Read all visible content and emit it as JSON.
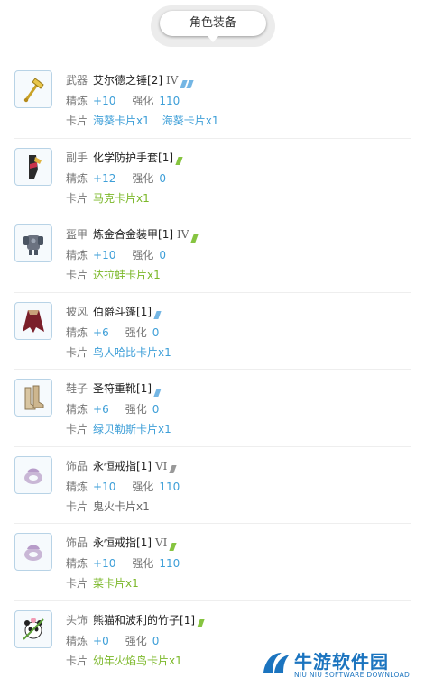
{
  "header": {
    "title": "角色装备"
  },
  "labels": {
    "refine": "精炼",
    "enhance": "强化",
    "card": "卡片"
  },
  "colors": {
    "blue": "#3e9fd8",
    "green": "#7cb82a",
    "gray": "#888888",
    "slash_blue": "#74b6e4",
    "slash_green": "#86c440",
    "slash_gray": "#999999"
  },
  "items": [
    {
      "slot": "武器",
      "name": "艾尔德之锤[2]",
      "tier": "IV",
      "slash_color": "blue",
      "slash_count": 2,
      "icon": "hammer-icon",
      "refine": "+10",
      "enhance": "110",
      "value_color": "blue",
      "cards": [
        "海葵卡片x1",
        "海葵卡片x1"
      ],
      "card_color": "blue"
    },
    {
      "slot": "副手",
      "name": "化学防护手套[1]",
      "tier": "",
      "slash_color": "green",
      "slash_count": 1,
      "icon": "glove-icon",
      "refine": "+12",
      "enhance": "0",
      "value_color": "blue",
      "cards": [
        "马克卡片x1"
      ],
      "card_color": "green"
    },
    {
      "slot": "盔甲",
      "name": "炼金合金装甲[1]",
      "tier": "IV",
      "slash_color": "green",
      "slash_count": 1,
      "icon": "armor-icon",
      "refine": "+10",
      "enhance": "0",
      "value_color": "blue",
      "cards": [
        "达拉蛙卡片x1"
      ],
      "card_color": "green"
    },
    {
      "slot": "披风",
      "name": "伯爵斗篷[1]",
      "tier": "",
      "slash_color": "blue",
      "slash_count": 1,
      "icon": "cape-icon",
      "refine": "+6",
      "enhance": "0",
      "value_color": "blue",
      "cards": [
        "鸟人哈比卡片x1"
      ],
      "card_color": "blue"
    },
    {
      "slot": "鞋子",
      "name": "圣符重靴[1]",
      "tier": "",
      "slash_color": "blue",
      "slash_count": 1,
      "icon": "boots-icon",
      "refine": "+6",
      "enhance": "0",
      "value_color": "blue",
      "cards": [
        "绿贝勒斯卡片x1"
      ],
      "card_color": "blue"
    },
    {
      "slot": "饰品",
      "name": "永恒戒指[1]",
      "tier": "VI",
      "slash_color": "gray",
      "slash_count": 1,
      "icon": "ring-icon",
      "refine": "+10",
      "enhance": "110",
      "value_color": "blue",
      "cards": [
        "鬼火卡片x1"
      ],
      "card_color": "gray"
    },
    {
      "slot": "饰品",
      "name": "永恒戒指[1]",
      "tier": "VI",
      "slash_color": "green",
      "slash_count": 1,
      "icon": "ring-icon",
      "refine": "+10",
      "enhance": "110",
      "value_color": "blue",
      "cards": [
        "菜卡片x1"
      ],
      "card_color": "green"
    },
    {
      "slot": "头饰",
      "name": "熊猫和波利的竹子[1]",
      "tier": "",
      "slash_color": "green",
      "slash_count": 1,
      "icon": "panda-headgear-icon",
      "refine": "+0",
      "enhance": "0",
      "value_color": "blue",
      "cards": [
        "幼年火焰鸟卡片x1"
      ],
      "card_color": "green"
    }
  ],
  "watermark": {
    "title": "牛游软件园",
    "subtitle": "NIU NIU SOFTWARE DOWNLOAD"
  }
}
